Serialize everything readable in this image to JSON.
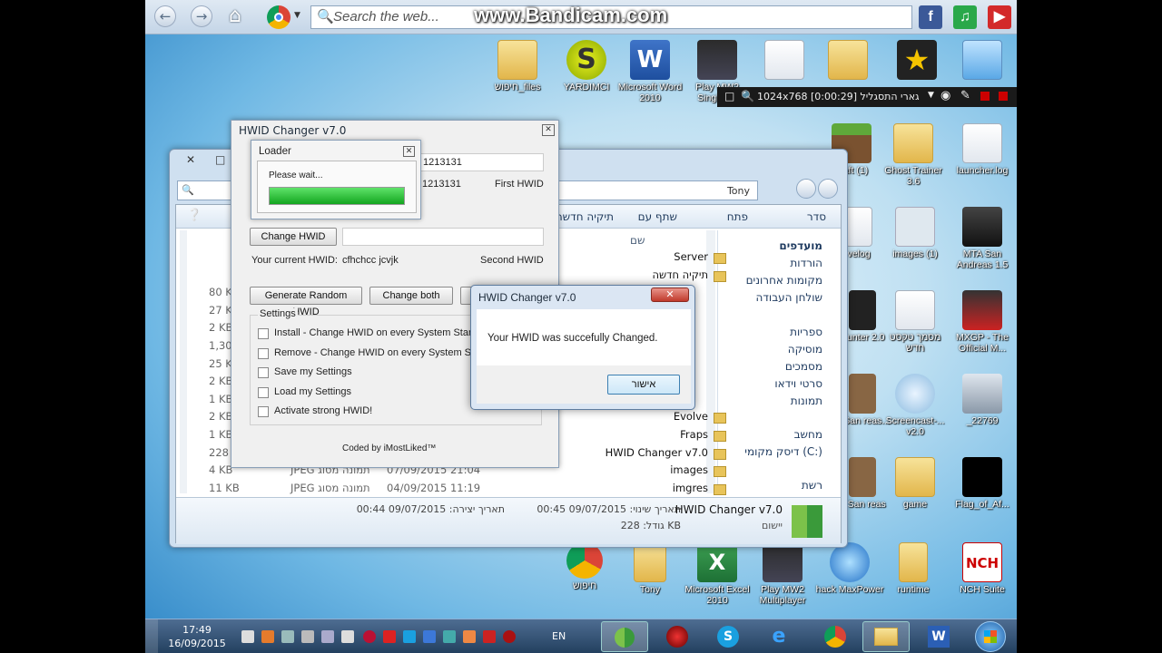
{
  "browser": {
    "search_placeholder": "Search the web...",
    "watermark": "www.Bandicam.com"
  },
  "desktop_icons": [
    {
      "label": "חיפוש_files",
      "kind": "folder"
    },
    {
      "label": "YARDIMCI",
      "kind": "app"
    },
    {
      "label": "Microsoft Word 2010",
      "kind": "word"
    },
    {
      "label": "Play MW2 Singlep...",
      "kind": "app"
    },
    {
      "label": "",
      "kind": "doc"
    },
    {
      "label": "",
      "kind": "folder"
    },
    {
      "label": "",
      "kind": "app"
    },
    {
      "label": "",
      "kind": "app"
    },
    {
      "label": "craft (1)",
      "kind": "app"
    },
    {
      "label": "Ghost Trainer 3.6",
      "kind": "folder"
    },
    {
      "label": "launcher.log",
      "kind": "doc"
    },
    {
      "label": "velog",
      "kind": "doc"
    },
    {
      "label": "images (1)",
      "kind": "image"
    },
    {
      "label": "MTA San Andreas 1.5",
      "kind": "app"
    },
    {
      "label": "Hunter 2.0",
      "kind": "app"
    },
    {
      "label": "מסמך טקסט חדש",
      "kind": "doc"
    },
    {
      "label": "MXGP - The Official M...",
      "kind": "app"
    },
    {
      "label": "A San reas...",
      "kind": "app"
    },
    {
      "label": "Screencast-... v2.0",
      "kind": "app"
    },
    {
      "label": "_22769",
      "kind": "image"
    },
    {
      "label": "A San reas",
      "kind": "app"
    },
    {
      "label": "game",
      "kind": "folder"
    },
    {
      "label": "Flag_of_Af...",
      "kind": "image"
    },
    {
      "label": "חיפוש",
      "kind": "chrome"
    },
    {
      "label": "Tony",
      "kind": "folder"
    },
    {
      "label": "Microsoft Excel 2010",
      "kind": "excel"
    },
    {
      "label": "Play MW2 Multiplayer",
      "kind": "app"
    },
    {
      "label": "hack MaxPower",
      "kind": "app"
    },
    {
      "label": "runtime",
      "kind": "folder"
    },
    {
      "label": "NCH Suite",
      "kind": "app"
    }
  ],
  "recorder": {
    "status": "1024x768 [0:00:29] גארי התסגליל"
  },
  "explorer": {
    "breadcrumb": "Tony",
    "toolbar": [
      "סדר",
      "פתח",
      "שתף עם",
      "תיקיה חדשה"
    ],
    "column_name": "שם",
    "nav": [
      "מועדפים",
      "הורדות",
      "מקומות אחרונים",
      "שולחן העבודה",
      "ספריות",
      "מוסיקה",
      "מסמכים",
      "סרטי וידאו",
      "תמונות",
      "מחשב",
      "דיסק מקומי (C:)",
      "רשת"
    ],
    "files": [
      {
        "name": "Server",
        "size": "",
        "type": "",
        "date": ""
      },
      {
        "name": "תיקיה חדשה",
        "size": "",
        "type": "",
        "date": ""
      },
      {
        "name": "",
        "size": "80 K",
        "type": "",
        "date": ""
      },
      {
        "name": "",
        "size": "27 K",
        "type": "",
        "date": ""
      },
      {
        "name": "",
        "size": "2 KB",
        "type": "",
        "date": ""
      },
      {
        "name": "",
        "size": "1,30",
        "type": "",
        "date": ""
      },
      {
        "name": "",
        "size": "25 K",
        "type": "",
        "date": ""
      },
      {
        "name": "",
        "size": "2 KB",
        "type": "",
        "date": ""
      },
      {
        "name": "",
        "size": "1 KB",
        "type": "",
        "date": ""
      },
      {
        "name": "Evolve",
        "size": "2 KB",
        "type": "",
        "date": ""
      },
      {
        "name": "Fraps",
        "size": "1 KB",
        "type": "",
        "date": ""
      },
      {
        "name": "HWID Changer v7.0",
        "size": "228",
        "type": "",
        "date": ""
      },
      {
        "name": "images",
        "size": "4 KB",
        "type": "JPEG תמונה מסוג",
        "date": "07/09/2015 21:04"
      },
      {
        "name": "imgres",
        "size": "11 KB",
        "type": "JPEG תמונה מסוג",
        "date": "04/09/2015 11:19"
      }
    ],
    "details": {
      "name": "HWID Changer v7.0",
      "kind": "יישום",
      "modified": "תאריך שינוי: 09/07/2015 00:45",
      "created": "תאריך יצירה: 09/07/2015 00:44",
      "size": "גודל: 228 KB"
    }
  },
  "hwid": {
    "title": "HWID Changer v7.0",
    "first_value": "1213131",
    "first_value_b": "1213131",
    "first_label": "First HWID",
    "change_btn": "Change HWID",
    "current_label": "Your current HWID:",
    "current_value": "cfhchcc jcvjk",
    "second_label": "Second HWID",
    "gen_btn": "Generate Random HWID",
    "both_btn": "Change both",
    "settings_label": "Settings",
    "opts": [
      "Install - Change HWID on every System StartUp",
      "Remove - Change HWID on every System StartUp",
      "Save my Settings",
      "Load my Settings",
      "Activate strong HWID!"
    ],
    "coded_by": "Coded by iMostLiked™"
  },
  "loader": {
    "title": "Loader",
    "message": "Please wait...",
    "progress": 1.0
  },
  "msgbox": {
    "title": "HWID Changer v7.0",
    "message": "Your HWID was succefully Changed.",
    "ok": "אישור"
  },
  "taskbar": {
    "time": "17:49",
    "date": "16/09/2015",
    "lang": "EN"
  }
}
